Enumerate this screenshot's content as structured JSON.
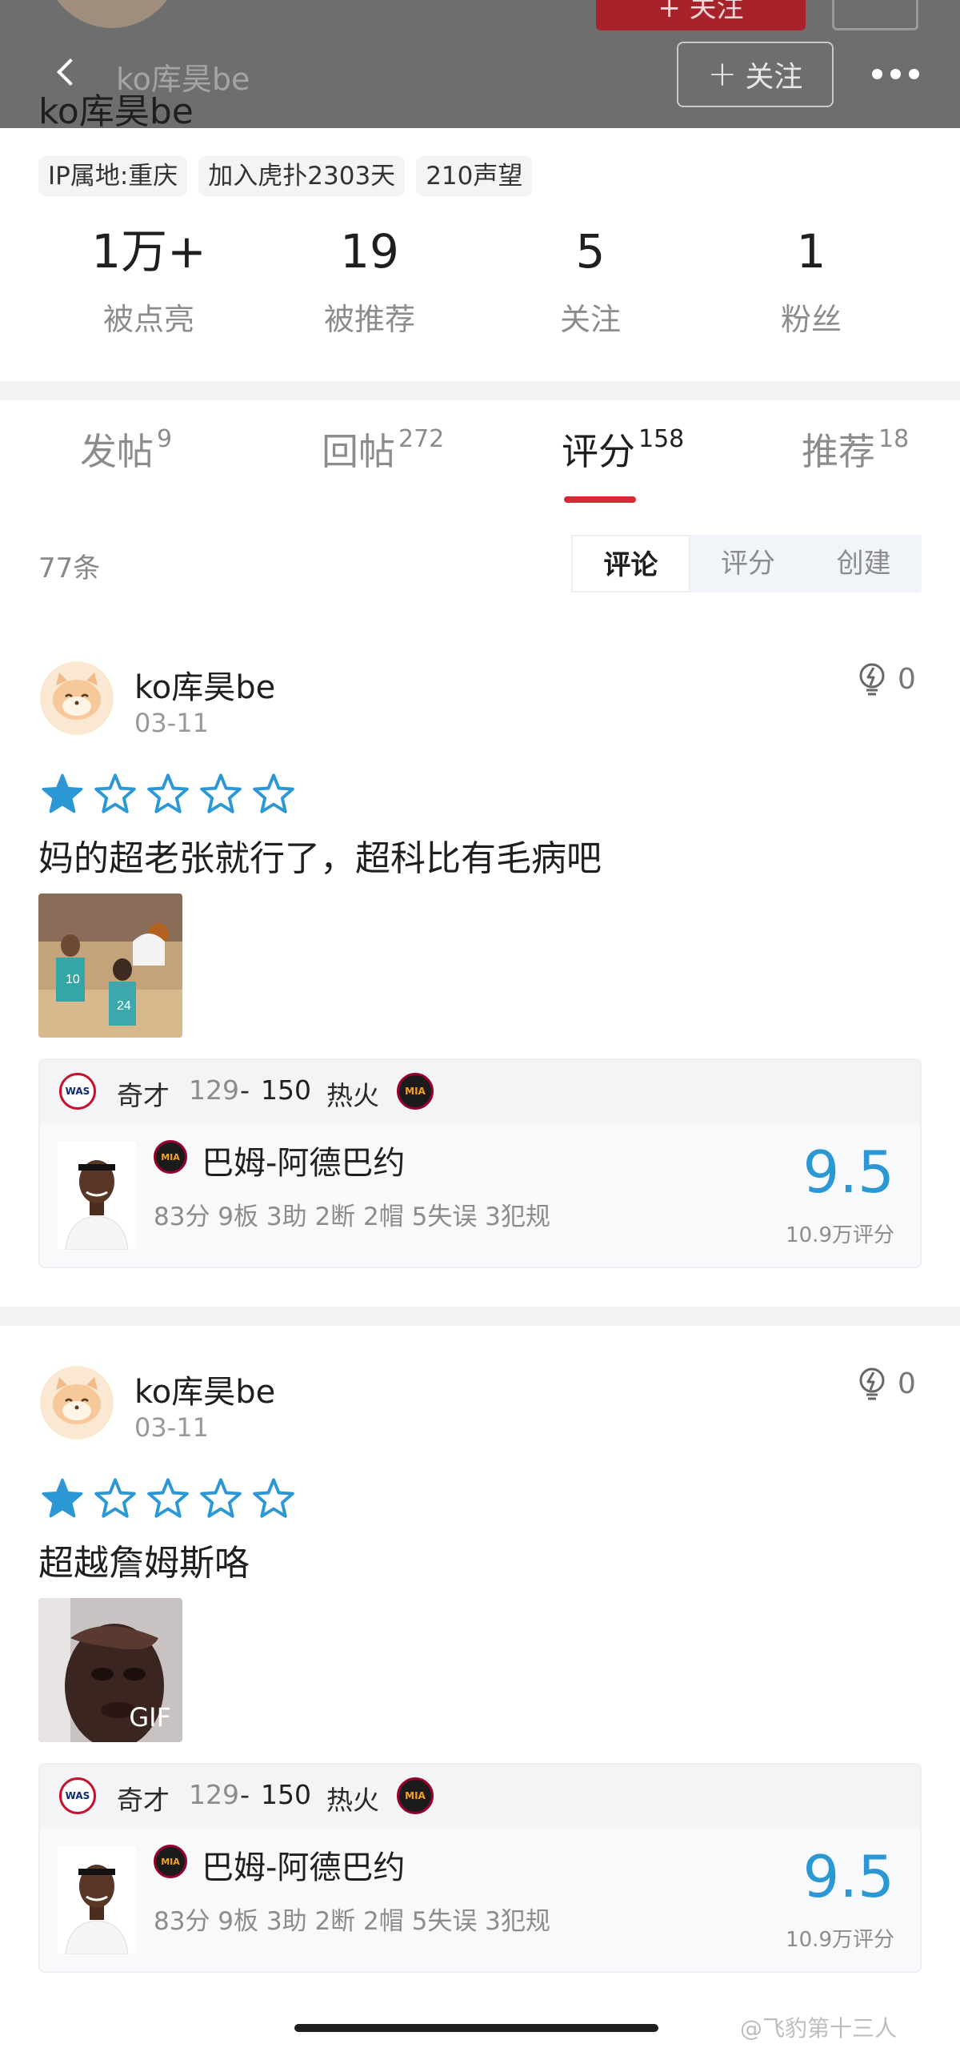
{
  "header": {
    "bg_follow_label": "+ 关注",
    "name_faded": "ko库昊be",
    "name": "ko库昊be",
    "follow_label": "关注"
  },
  "profile": {
    "chips": [
      "IP属地:重庆",
      "加入虎扑2303天",
      "210声望"
    ],
    "stats": [
      {
        "num": "1万+",
        "label": "被点亮"
      },
      {
        "num": "19",
        "label": "被推荐"
      },
      {
        "num": "5",
        "label": "关注"
      },
      {
        "num": "1",
        "label": "粉丝"
      }
    ]
  },
  "tabs": [
    {
      "label": "发帖",
      "count": "9"
    },
    {
      "label": "回帖",
      "count": "272"
    },
    {
      "label": "评分",
      "count": "158"
    },
    {
      "label": "推荐",
      "count": "18"
    }
  ],
  "filter": {
    "count_text": "77条",
    "segments": [
      "评论",
      "评分",
      "创建"
    ]
  },
  "posts": [
    {
      "user": "ko库昊be",
      "date": "03-11",
      "lights": "0",
      "stars": 1,
      "text": "妈的超老张就行了，超科比有毛病吧",
      "gif": "",
      "match": {
        "away_logo": "WAS",
        "away_team": "奇才",
        "away_score": "129",
        "sep": "-",
        "home_score": "150",
        "home_team": "热火",
        "home_logo": "MIA",
        "player_logo": "MIA",
        "player_name": "巴姆-阿德巴约",
        "player_stats": "83分 9板 3助 2断 2帽 5失误 3犯规",
        "rating": "9.5",
        "rating_count": "10.9万评分"
      }
    },
    {
      "user": "ko库昊be",
      "date": "03-11",
      "lights": "0",
      "stars": 1,
      "text": "超越詹姆斯咯",
      "gif": "GIF",
      "match": {
        "away_logo": "WAS",
        "away_team": "奇才",
        "away_score": "129",
        "sep": "-",
        "home_score": "150",
        "home_team": "热火",
        "home_logo": "MIA",
        "player_logo": "MIA",
        "player_name": "巴姆-阿德巴约",
        "player_stats": "83分 9板 3助 2断 2帽 5失误 3犯规",
        "rating": "9.5",
        "rating_count": "10.9万评分"
      }
    }
  ],
  "watermark": "@飞豹第十三人",
  "colors": {
    "accent_red": "#d42a36",
    "star_blue": "#2b97d4",
    "rating_blue": "#2b97d4",
    "header_gray": "#6e6e6e"
  },
  "icons": {
    "back": "chevron-left-icon",
    "more": "more-dots-icon",
    "light": "lightbulb-icon",
    "star": "star-icon",
    "plus": "plus-icon"
  }
}
